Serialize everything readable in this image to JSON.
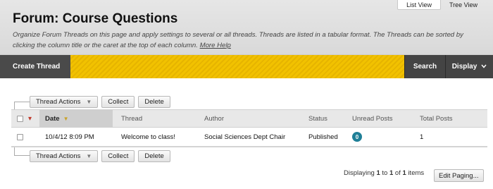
{
  "header": {
    "title": "Forum: Course Questions",
    "description": "Organize Forum Threads on this page and apply settings to several or all threads. Threads are listed in a tabular format. The Threads can be sorted by clicking the column title or the caret at the top of each column.",
    "more_help": "More Help"
  },
  "view_tabs": [
    {
      "label": "List View",
      "active": true
    },
    {
      "label": "Tree View",
      "active": false
    }
  ],
  "action_bar": {
    "create_thread": "Create Thread",
    "search": "Search",
    "display": "Display",
    "accent_color": "#f2c200"
  },
  "toolbar": {
    "thread_actions": "Thread Actions",
    "collect": "Collect",
    "delete": "Delete"
  },
  "table": {
    "columns": [
      "Date",
      "Thread",
      "Author",
      "Status",
      "Unread Posts",
      "Total Posts"
    ],
    "rows": [
      {
        "date": "10/4/12 8:09 PM",
        "thread": "Welcome to class!",
        "author": "Social Sciences Dept Chair",
        "status": "Published",
        "unread": "0",
        "total": "1"
      }
    ]
  },
  "paging": {
    "prefix": "Displaying",
    "from": "1",
    "to_word": "to",
    "to": "1",
    "of_word": "of",
    "total": "1",
    "suffix": "items",
    "edit_paging": "Edit Paging..."
  }
}
